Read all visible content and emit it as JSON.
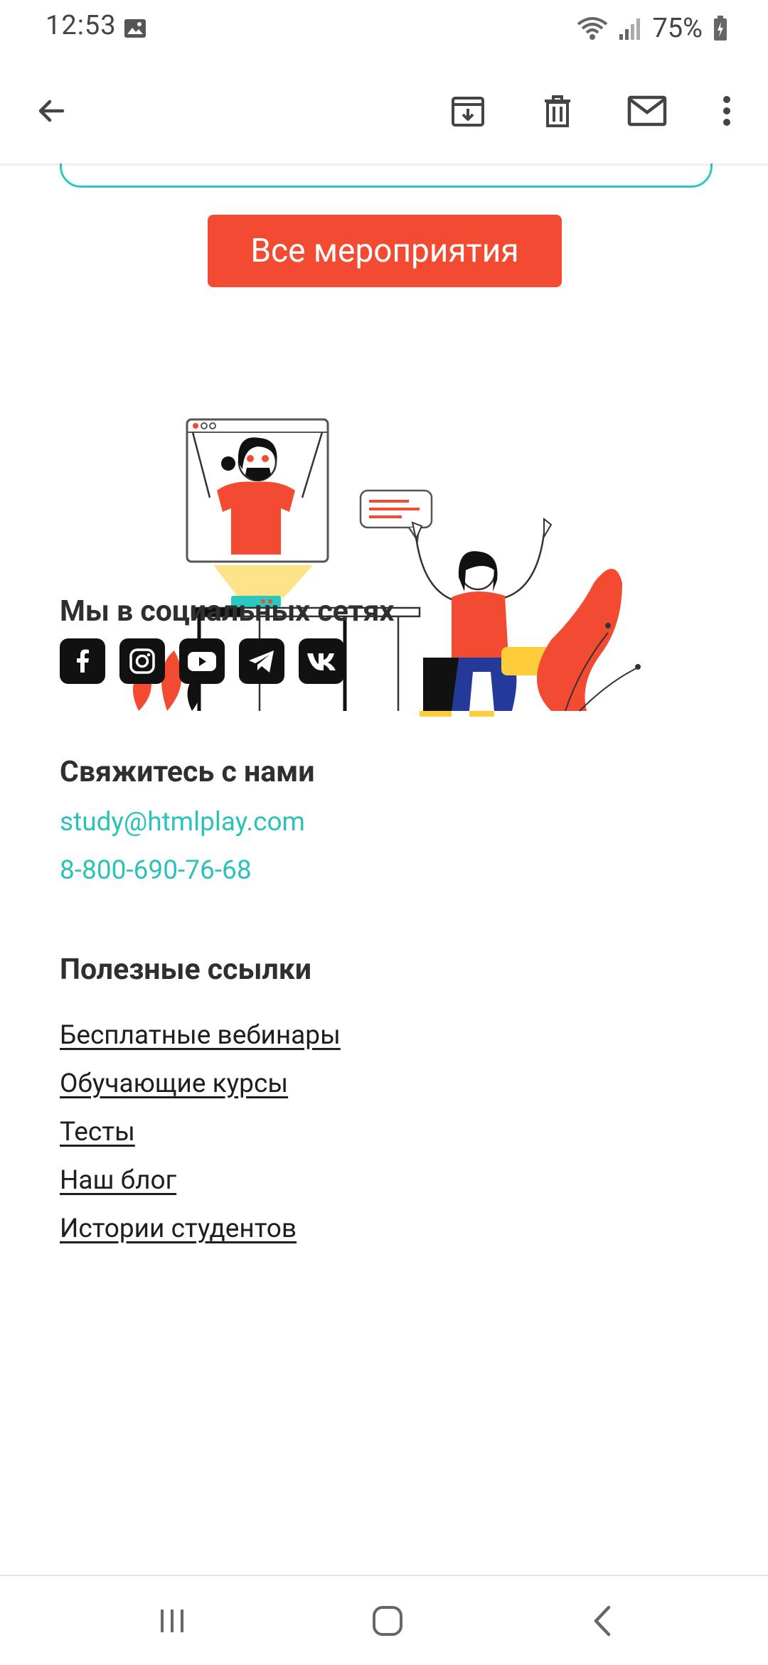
{
  "status_bar": {
    "time": "12:53",
    "battery_percent": "75%"
  },
  "app_bar": {
    "icons": [
      "back-arrow-icon",
      "archive-icon",
      "delete-icon",
      "mark-unread-icon",
      "more-vert-icon"
    ]
  },
  "main": {
    "cta_label": "Все мероприятия",
    "socials_title": "Мы в социальных сетях",
    "social_icons": [
      "facebook-icon",
      "instagram-icon",
      "youtube-icon",
      "telegram-icon",
      "vk-icon"
    ],
    "contact_title": "Свяжитесь с нами",
    "email": "study@htmlplay.com",
    "phone": "8-800-690-76-68",
    "links_title": "Полезные ссылки",
    "links": [
      "Бесплатные вебинары",
      "Обучающие курсы",
      "Тесты",
      "Наш блог",
      "Истории студентов"
    ]
  },
  "colors": {
    "accent": "#f34b31",
    "teal": "#2bc2b8",
    "text": "#2f2f2f"
  },
  "nav_bar": {
    "icons": [
      "recent-apps-icon",
      "home-icon",
      "back-icon"
    ]
  }
}
